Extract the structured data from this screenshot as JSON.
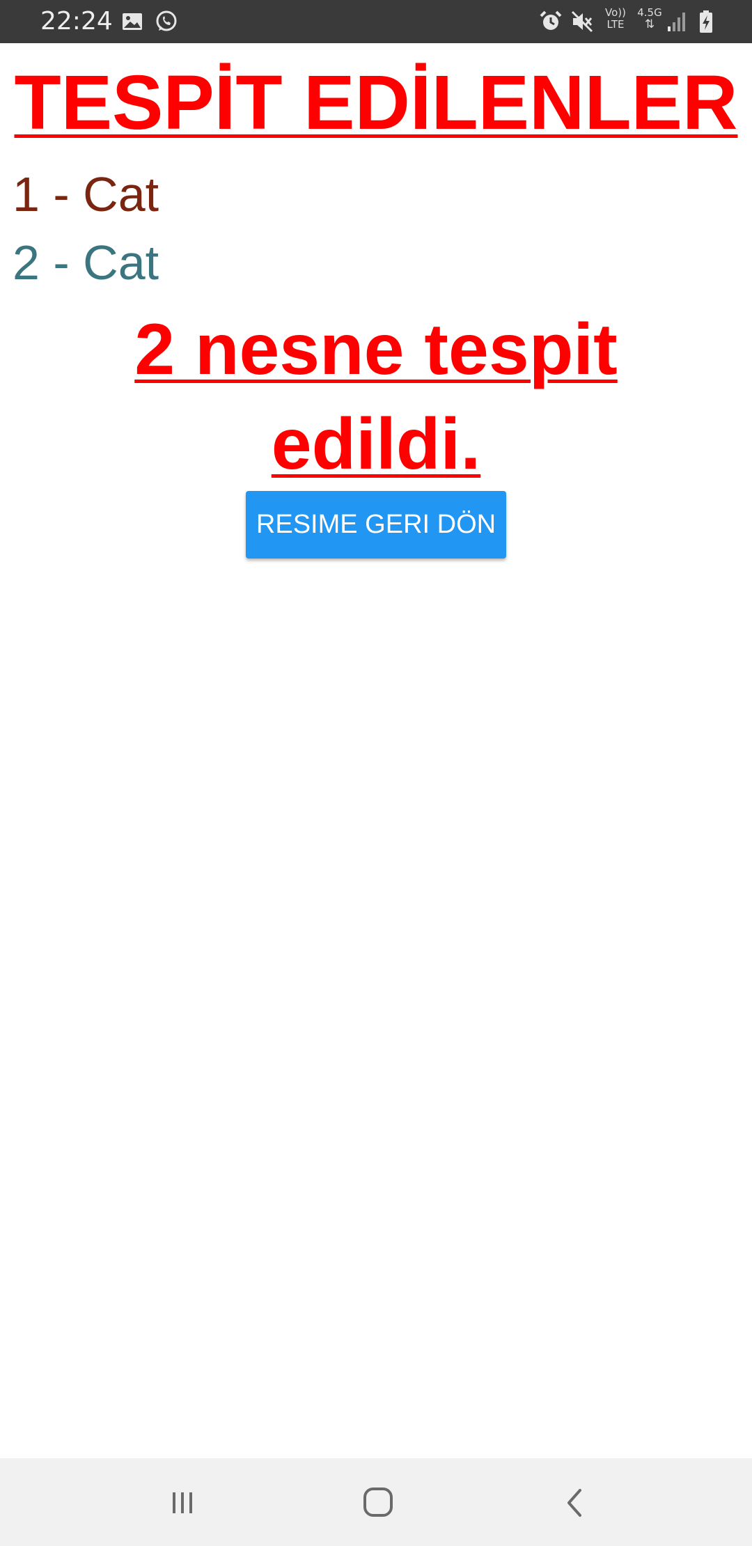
{
  "status_bar": {
    "time": "22:24",
    "network_label_top": "4.5G",
    "volte_label_top": "Vo))",
    "volte_label_bottom": "LTE",
    "icons": [
      "gallery-icon",
      "whatsapp-icon",
      "alarm-icon",
      "mute-icon",
      "volte-icon",
      "network-4-5g-icon",
      "signal-icon",
      "battery-charging-icon"
    ]
  },
  "page": {
    "title": "TESPİT EDİLENLER",
    "detected_items": [
      {
        "label": "1 - Cat",
        "color": "#7a2510"
      },
      {
        "label": "2 - Cat",
        "color": "#3a7580"
      }
    ],
    "summary": "2 nesne tespit edildi.",
    "back_button_label": "RESIME GERI DÖN"
  },
  "colors": {
    "title": "#ff0000",
    "button": "#2196f3",
    "status_bar": "#3a3a3a",
    "nav_bar": "#f1f1f1"
  },
  "nav_bar": {
    "icons": [
      "recent-apps-icon",
      "home-icon",
      "back-icon"
    ]
  }
}
